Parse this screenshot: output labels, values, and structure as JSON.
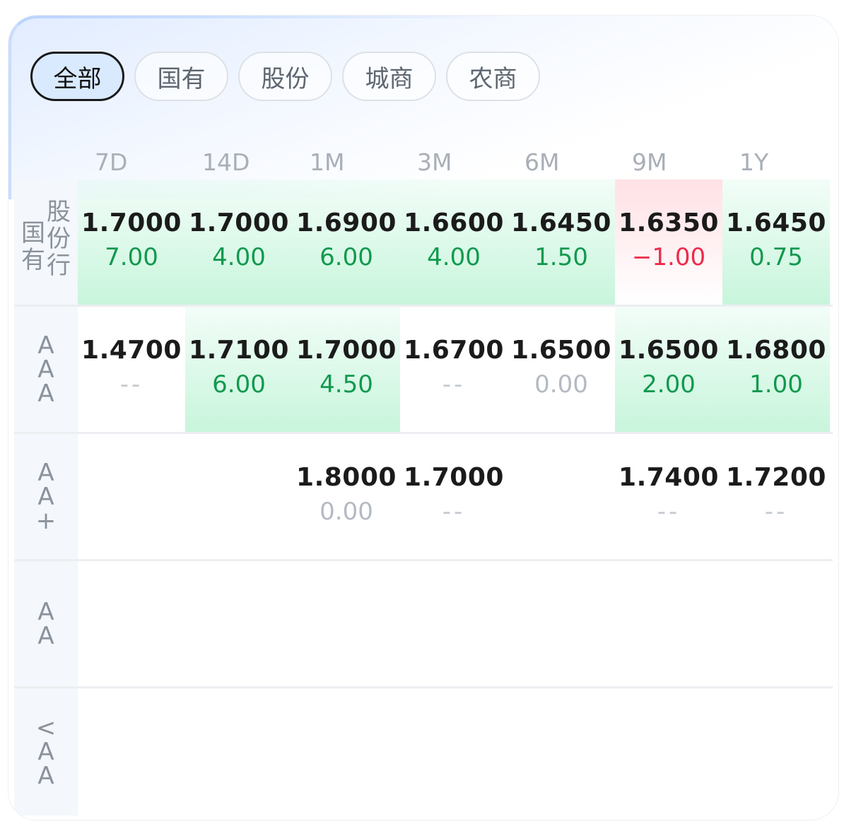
{
  "tabs": [
    "全部",
    "国有",
    "股份",
    "城商",
    "农商"
  ],
  "active_tab": 0,
  "columns": [
    "7D",
    "14D",
    "1M",
    "3M",
    "6M",
    "9M",
    "1Y"
  ],
  "colors": {
    "up": "#12994f",
    "down": "#ee2b4a",
    "flat": "#b4bac3",
    "up_bg": "#c8f5dc",
    "down_bg": "#ffe1e5"
  },
  "rows": [
    {
      "label_cols": [
        [
          "国",
          "有"
        ],
        [
          "股",
          "份",
          "行"
        ]
      ],
      "cells": [
        {
          "rate": "1.7000",
          "chg": "7.00",
          "dir": "up"
        },
        {
          "rate": "1.7000",
          "chg": "4.00",
          "dir": "up"
        },
        {
          "rate": "1.6900",
          "chg": "6.00",
          "dir": "up"
        },
        {
          "rate": "1.6600",
          "chg": "4.00",
          "dir": "up"
        },
        {
          "rate": "1.6450",
          "chg": "1.50",
          "dir": "up"
        },
        {
          "rate": "1.6350",
          "chg": "−1.00",
          "dir": "down"
        },
        {
          "rate": "1.6450",
          "chg": "0.75",
          "dir": "up"
        }
      ]
    },
    {
      "label": [
        "A",
        "A",
        "A"
      ],
      "cells": [
        {
          "rate": "1.4700",
          "chg": "--",
          "dir": "none"
        },
        {
          "rate": "1.7100",
          "chg": "6.00",
          "dir": "up"
        },
        {
          "rate": "1.7000",
          "chg": "4.50",
          "dir": "up"
        },
        {
          "rate": "1.6700",
          "chg": "--",
          "dir": "none"
        },
        {
          "rate": "1.6500",
          "chg": "0.00",
          "dir": "flat"
        },
        {
          "rate": "1.6500",
          "chg": "2.00",
          "dir": "up"
        },
        {
          "rate": "1.6800",
          "chg": "1.00",
          "dir": "up"
        }
      ]
    },
    {
      "label": [
        "A",
        "A",
        "+"
      ],
      "cells": [
        null,
        null,
        {
          "rate": "1.8000",
          "chg": "0.00",
          "dir": "flat"
        },
        {
          "rate": "1.7000",
          "chg": "--",
          "dir": "none"
        },
        null,
        {
          "rate": "1.7400",
          "chg": "--",
          "dir": "none"
        },
        {
          "rate": "1.7200",
          "chg": "--",
          "dir": "none"
        }
      ]
    },
    {
      "label": [
        "A",
        "A"
      ],
      "cells": [
        null,
        null,
        null,
        null,
        null,
        null,
        null
      ]
    },
    {
      "label": [
        "<",
        "A",
        "A"
      ],
      "cells": [
        null,
        null,
        null,
        null,
        null,
        null,
        null
      ]
    }
  ]
}
